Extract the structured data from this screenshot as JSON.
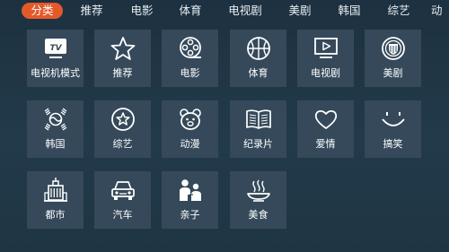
{
  "nav": {
    "tabs": [
      "分类",
      "推荐",
      "电影",
      "体育",
      "电视剧",
      "美剧",
      "韩国",
      "综艺",
      "动"
    ]
  },
  "grid": {
    "items": [
      {
        "label": "电视机模式",
        "icon": "tv-icon"
      },
      {
        "label": "推荐",
        "icon": "star-icon"
      },
      {
        "label": "电影",
        "icon": "film-reel-icon"
      },
      {
        "label": "体育",
        "icon": "basketball-icon"
      },
      {
        "label": "电视剧",
        "icon": "video-screen-icon"
      },
      {
        "label": "美剧",
        "icon": "us-shield-icon"
      },
      {
        "label": "韩国",
        "icon": "korea-emblem-icon"
      },
      {
        "label": "综艺",
        "icon": "star-circle-icon"
      },
      {
        "label": "动漫",
        "icon": "bear-icon"
      },
      {
        "label": "纪录片",
        "icon": "book-icon"
      },
      {
        "label": "爱情",
        "icon": "heart-icon"
      },
      {
        "label": "搞笑",
        "icon": "smile-icon"
      },
      {
        "label": "都市",
        "icon": "city-building-icon"
      },
      {
        "label": "汽车",
        "icon": "car-icon"
      },
      {
        "label": "亲子",
        "icon": "parent-child-icon"
      },
      {
        "label": "美食",
        "icon": "food-dish-icon"
      }
    ]
  },
  "colors": {
    "accent": "#e4592a",
    "background": "#213746",
    "tile": "#35495a",
    "text": "#ffffff"
  }
}
